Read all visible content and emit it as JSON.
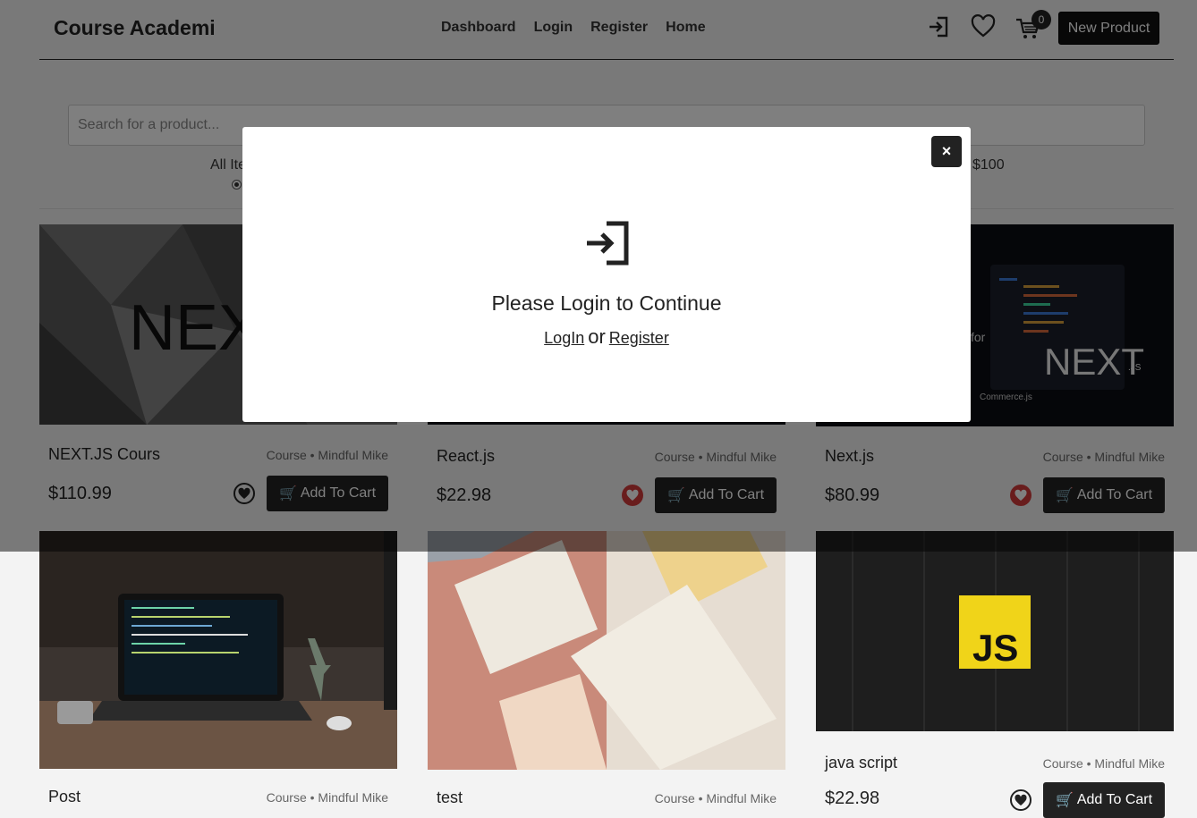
{
  "header": {
    "brand": "Course Academi",
    "nav": [
      "Dashboard",
      "Login",
      "Register",
      "Home"
    ],
    "cart_count": "0",
    "new_product_label": "New Product"
  },
  "search": {
    "placeholder": "Search for a product..."
  },
  "filters": {
    "left_label": "All Ite",
    "right_label": "$100"
  },
  "products": [
    {
      "title": "NEXT.JS Cours",
      "meta": "Course • Mindful Mike",
      "price": "$110.99",
      "favorited": false,
      "cta": "Add To Cart",
      "image_text": "NEXT"
    },
    {
      "title": "React.js",
      "meta": "Course • Mindful Mike",
      "price": "$22.98",
      "favorited": true,
      "cta": "Add To Cart"
    },
    {
      "title": "Next.js",
      "meta": "Course • Mindful Mike",
      "price": "$80.99",
      "favorited": true,
      "cta": "Add To Cart",
      "image_text": "NEXT",
      "image_subtext": ".JS",
      "image_badge": "Commerce.js",
      "image_for": "for"
    },
    {
      "title": "Post",
      "meta": "Course • Mindful Mike",
      "price": "",
      "favorited": false,
      "cta": ""
    },
    {
      "title": "test",
      "meta": "Course • Mindful Mike",
      "price": "",
      "favorited": false,
      "cta": ""
    },
    {
      "title": "java script",
      "meta": "Course • Mindful Mike",
      "price": "$22.98",
      "favorited": false,
      "cta": "Add To Cart",
      "image_text": "JS"
    }
  ],
  "modal": {
    "close": "×",
    "message": "Please Login to Continue",
    "login_link": "LogIn",
    "or": "or",
    "register_link": "Register"
  },
  "colors": {
    "fav_active": "#d33b3b",
    "button_bg": "#222222",
    "overlay": "rgba(0,0,0,0.5)"
  }
}
